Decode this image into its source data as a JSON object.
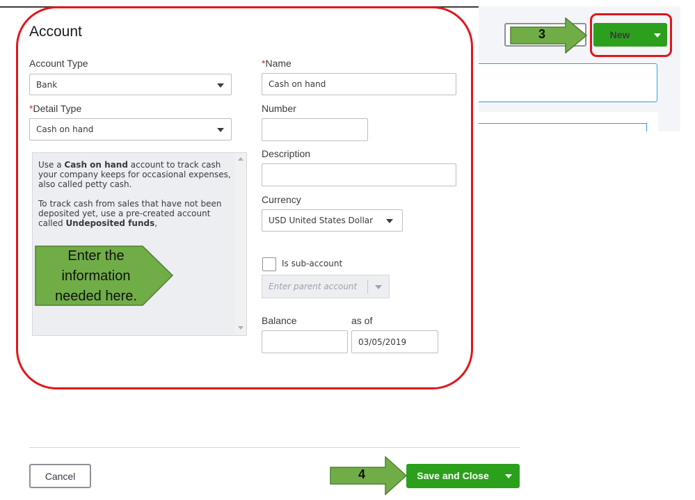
{
  "dialog": {
    "title": "Account",
    "account_type": {
      "label": "Account Type",
      "value": "Bank"
    },
    "detail_type": {
      "required_mark": "*",
      "label": "Detail Type",
      "value": "Cash on hand"
    },
    "help": {
      "p1_pre": "Use a ",
      "p1_bold": "Cash on hand",
      "p1_post": " account to track cash your company keeps for occasional expenses, also called petty cash.",
      "p2_pre": "To track cash from sales that have not been deposited yet, use a pre-created account called ",
      "p2_bold": "Undeposited funds",
      "p2_post": ","
    },
    "name": {
      "required_mark": "*",
      "label": "Name",
      "value": "Cash on hand"
    },
    "number": {
      "label": "Number",
      "value": ""
    },
    "description": {
      "label": "Description",
      "value": ""
    },
    "currency": {
      "label": "Currency",
      "value": "USD United States Dollar"
    },
    "sub_account": {
      "label": "Is sub-account",
      "checked": false,
      "parent_placeholder": "Enter parent account"
    },
    "balance": {
      "label": "Balance",
      "value": ""
    },
    "as_of": {
      "label": "as of",
      "value": "03/05/2019"
    }
  },
  "header": {
    "new_button_label": "New"
  },
  "footer": {
    "cancel_label": "Cancel",
    "save_label": "Save and Close"
  },
  "callouts": {
    "step3": "3",
    "step4": "4",
    "enter_info": [
      "Enter the",
      "information",
      "needed here."
    ]
  },
  "colors": {
    "accent_green": "#2ca01c",
    "highlight_red": "#e0161b",
    "callout_green": "#70ad47",
    "field_focus_blue": "#2ca0e0"
  },
  "icons": [
    "dropdown-caret-icon",
    "scroll-up-icon",
    "scroll-down-icon",
    "arrow-callout-icon"
  ]
}
